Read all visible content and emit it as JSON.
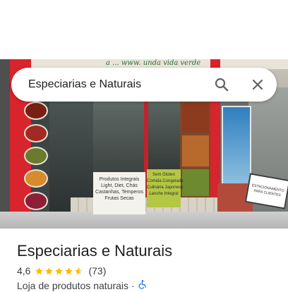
{
  "search": {
    "query": "Especiarias e Naturais"
  },
  "photo": {
    "awning_text": "a ... www. unda vida verde",
    "window_sign_lines": [
      "Produtos Integrais",
      "Light, Diet, Chás",
      "Castanhas, Temperos",
      "Frutas Secas"
    ],
    "green_sign_lines": [
      "Sem Glúten",
      "Comida Congelada",
      "Culinária Japonesa",
      "Lanche Integral"
    ],
    "parking_sign_lines": [
      "ESTACIONAMENTO",
      "PARA CLIENTES"
    ]
  },
  "place": {
    "name": "Especiarias e Naturais",
    "rating": "4,6",
    "rating_fraction": 0.92,
    "review_count": "(73)",
    "category": "Loja de produtos naturais",
    "separator": "·"
  },
  "colors": {
    "star": "#fbbc04",
    "star_empty": "#dadce0",
    "accent_blue": "#1a73e8",
    "text_primary": "#202124",
    "text_secondary": "#3c4043"
  },
  "icons": {
    "search": "search-icon",
    "close": "close-icon",
    "accessibility": "wheelchair-icon",
    "star": "star-icon"
  }
}
